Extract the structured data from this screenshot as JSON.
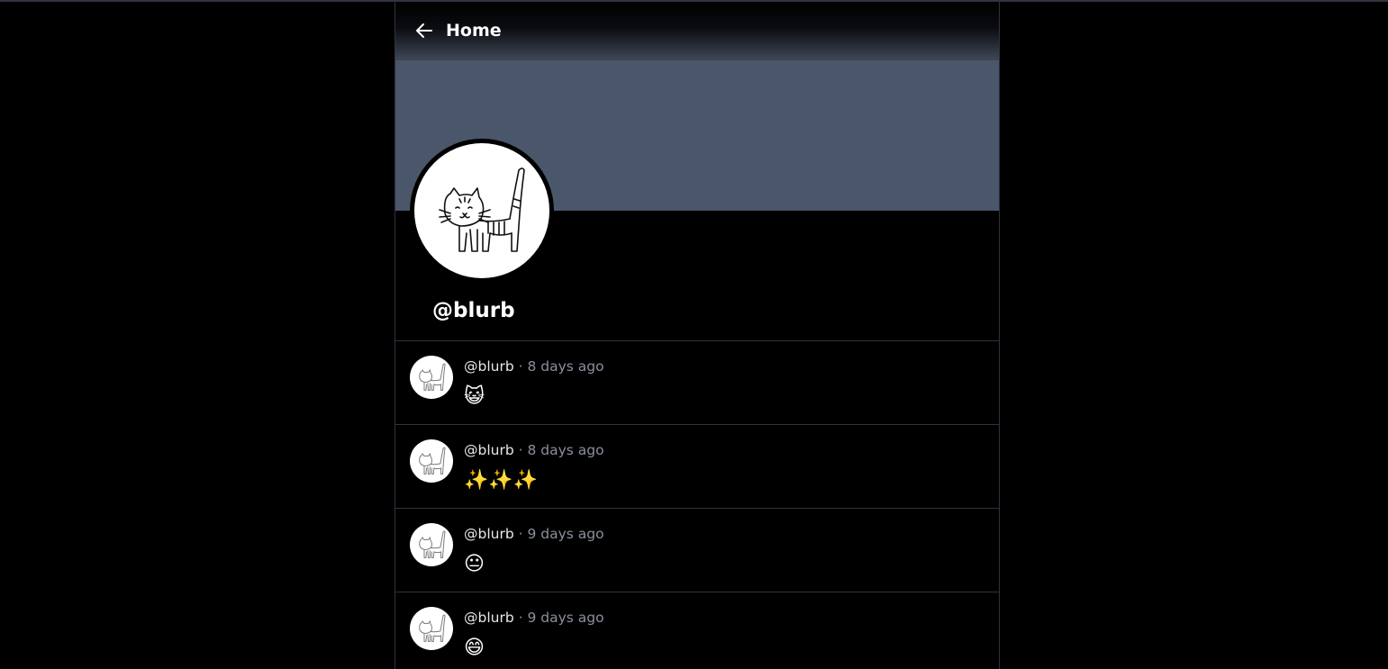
{
  "header": {
    "title": "Home",
    "back_icon": "arrow-left-icon"
  },
  "profile": {
    "handle": "@blurb",
    "avatar_icon": "cat-drawing-icon",
    "banner_color": "#4a5669"
  },
  "posts": [
    {
      "handle": "@blurb",
      "separator": "·",
      "time": "8 days ago",
      "content": "😺"
    },
    {
      "handle": "@blurb",
      "separator": "·",
      "time": "8 days ago",
      "content": "✨✨✨"
    },
    {
      "handle": "@blurb",
      "separator": "·",
      "time": "9 days ago",
      "content": "😐"
    },
    {
      "handle": "@blurb",
      "separator": "·",
      "time": "9 days ago",
      "content": "😄"
    }
  ]
}
